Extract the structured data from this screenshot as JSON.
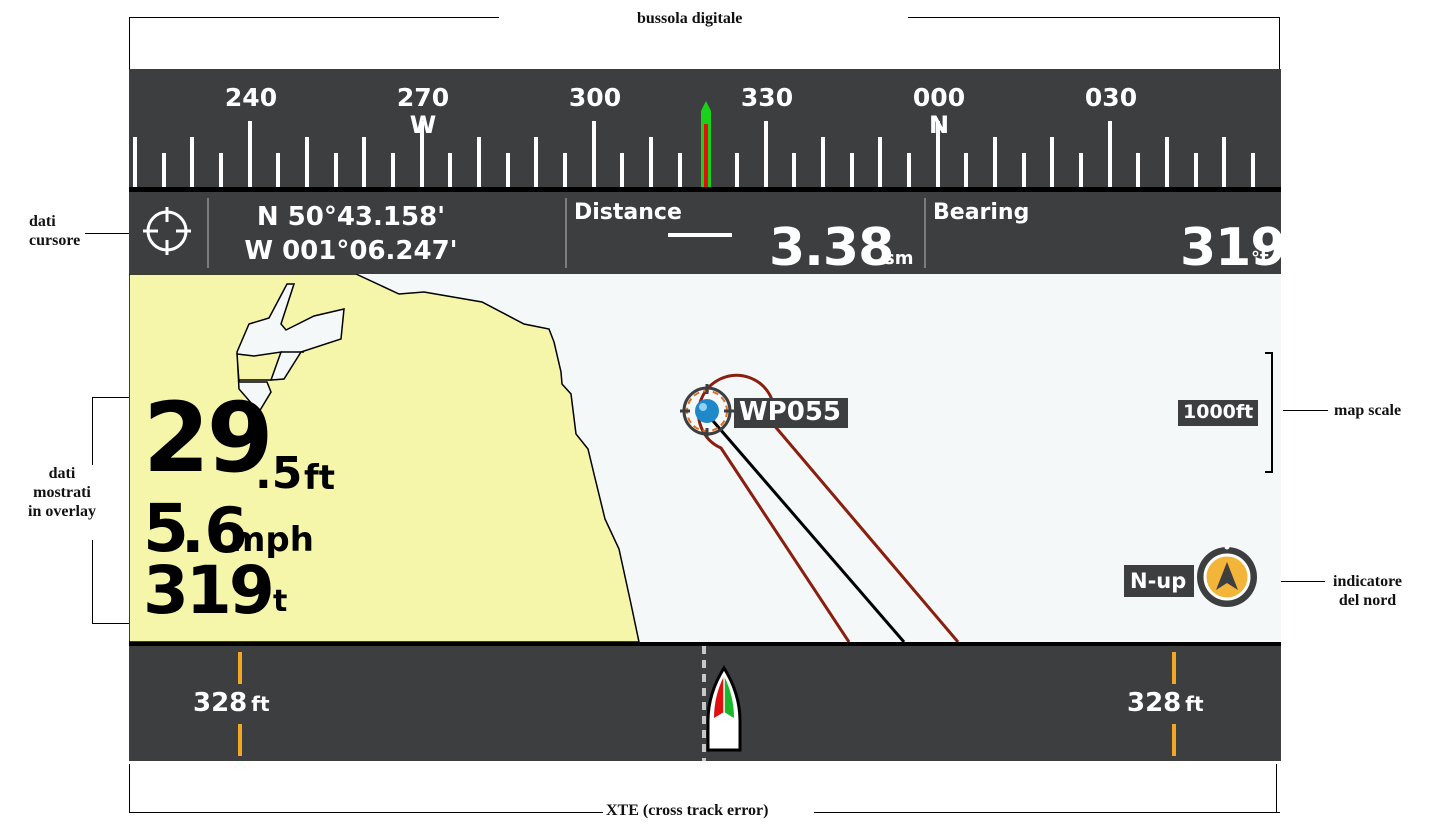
{
  "annotations": {
    "compass": "bussola digitale",
    "cursor_data_line1": "dati",
    "cursor_data_line2": "cursore",
    "overlay_line1": "dati",
    "overlay_line2": "mostrati",
    "overlay_line3": "in overlay",
    "map_scale": "map scale",
    "north_line1": "indicatore",
    "north_line2": "del nord",
    "xte": "XTE (cross track error)"
  },
  "compass": {
    "headings": [
      "240",
      "270",
      "300",
      "330",
      "000",
      "030"
    ],
    "cardinals": [
      "W",
      "N"
    ],
    "heading_marker_color": "#1ad21a",
    "heading_marker_inner_color": "#e01010"
  },
  "cursor": {
    "icon": "crosshair-icon",
    "lat": "N 50°43.158'",
    "lon": "W 001°06.247'"
  },
  "distance": {
    "label": "Distance",
    "value": "3.38",
    "unit": "sm"
  },
  "bearing": {
    "label": "Bearing",
    "value": "319",
    "unit": "°t"
  },
  "overlay": {
    "depth_value": "29",
    "depth_decimal": ".5",
    "depth_unit": "ft",
    "speed_value": "5",
    "speed_decimal": ".6",
    "speed_unit": "mph",
    "heading_value": "319",
    "heading_unit": "°t"
  },
  "map": {
    "waypoint": "WP055",
    "scale": "1000ft",
    "orientation": "N-up",
    "land_color": "#f6f6aa",
    "water_color": "#f4f8f8",
    "track_color": "#8a1e0f"
  },
  "xte": {
    "left_value": "328",
    "left_unit": "ft",
    "right_value": "328",
    "right_unit": "ft",
    "bar_color": "#f2a623"
  }
}
